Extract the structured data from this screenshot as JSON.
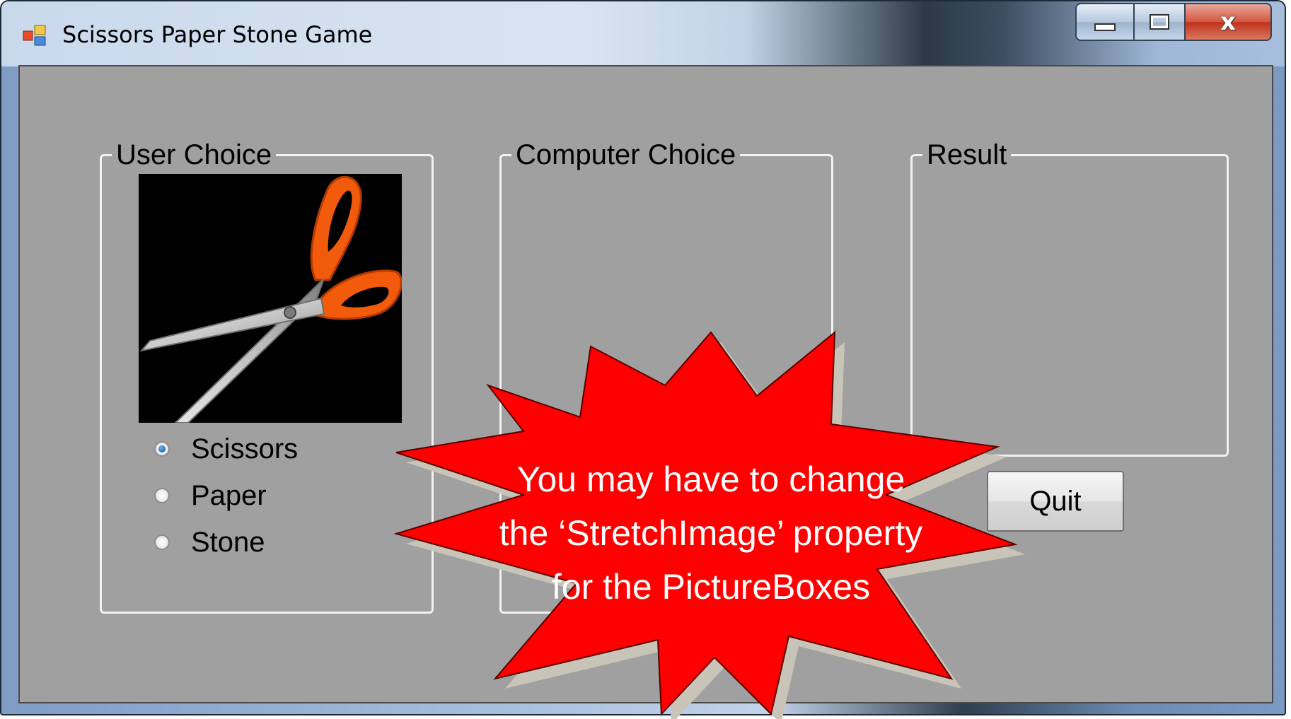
{
  "window": {
    "title": "Scissors Paper Stone Game",
    "icon": "windows-form-icon",
    "controls": {
      "minimize_icon": "minimize-icon",
      "maximize_icon": "maximize-icon",
      "close_glyph": "x"
    }
  },
  "groups": {
    "user_choice": {
      "title": "User Choice",
      "picture": "scissors-image",
      "options": [
        {
          "label": "Scissors",
          "checked": true
        },
        {
          "label": "Paper",
          "checked": false
        },
        {
          "label": "Stone",
          "checked": false
        }
      ]
    },
    "computer_choice": {
      "title": "Computer Choice"
    },
    "result": {
      "title": "Result"
    }
  },
  "quit_button": {
    "label": "Quit"
  },
  "callout": {
    "lines": [
      "You may have to change",
      "the ‘StretchImage’ property",
      "for the PictureBoxes"
    ],
    "fill": "#ff0000",
    "shadow": "#c8c4b8"
  },
  "colors": {
    "form_background": "#a0a0a0",
    "groupbox_border": "#f2f2f2",
    "picture_background": "#000000",
    "scissors_handle": "#f25a0c"
  }
}
